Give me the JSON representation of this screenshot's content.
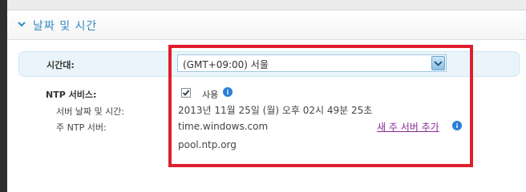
{
  "section": {
    "title": "날짜 및 시간"
  },
  "timezone": {
    "label": "시간대:",
    "selected_value": "(GMT+09:00) 서울"
  },
  "ntp": {
    "label": "NTP 서비스:",
    "enabled_label": "사용",
    "enabled": true,
    "server_datetime_label": "서버 날짜 및 시간:",
    "server_datetime_value": "2013년 11월 25일 (월) 오후 02시 49분 25초",
    "primary_server_label": "주 NTP 서버:",
    "servers": [
      "time.windows.com",
      "pool.ntp.org"
    ],
    "add_server_link": "새 주 서버 추가"
  },
  "colors": {
    "accent": "#2f8bc0",
    "highlight_box": "#e01e2b",
    "link": "#8a2a9a",
    "info": "#2a7fd4"
  },
  "icons": {
    "chevron": "chevron-down-icon",
    "select_arrow": "dropdown-arrow-icon",
    "info": "info-icon"
  }
}
